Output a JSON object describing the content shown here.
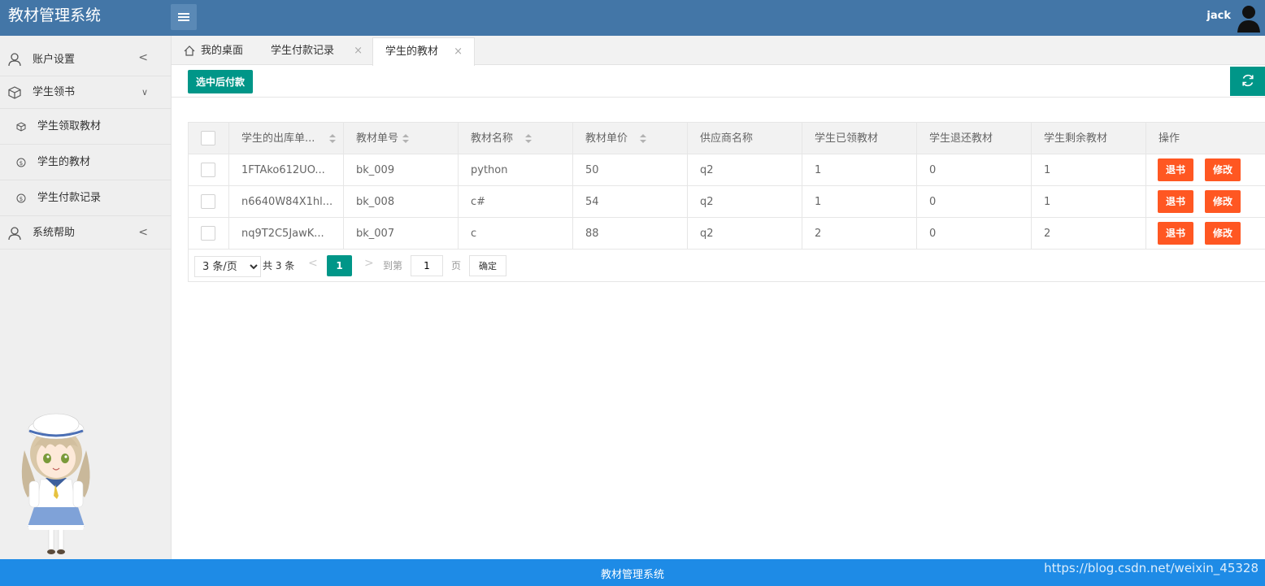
{
  "app": {
    "title": "教材管理系统",
    "user": "jack"
  },
  "sidebar": {
    "items": [
      {
        "label": "账户设置",
        "arrow": "<"
      },
      {
        "label": "学生领书",
        "arrow": "∨"
      },
      {
        "label": "学生领取教材"
      },
      {
        "label": "学生的教材"
      },
      {
        "label": "学生付款记录"
      },
      {
        "label": "系统帮助",
        "arrow": "<"
      }
    ]
  },
  "tabs": [
    {
      "label": "我的桌面"
    },
    {
      "label": "学生付款记录",
      "close": "×"
    },
    {
      "label": "学生的教材",
      "close": "×"
    }
  ],
  "toolbar": {
    "pay_label": "选中后付款"
  },
  "table": {
    "headers": [
      "学生的出库单...",
      "教材单号",
      "教材名称",
      "教材单价",
      "供应商名称",
      "学生已领教材",
      "学生退还教材",
      "学生剩余教材",
      "操作"
    ],
    "rows": [
      [
        "1FTAko612UO...",
        "bk_009",
        "python",
        "50",
        "q2",
        "1",
        "0",
        "1"
      ],
      [
        "n6640W84X1hl...",
        "bk_008",
        "c#",
        "54",
        "q2",
        "1",
        "0",
        "1"
      ],
      [
        "nq9T2C5JawK...",
        "bk_007",
        "c",
        "88",
        "q2",
        "2",
        "0",
        "2"
      ]
    ],
    "return_label": "退书",
    "edit_label": "修改"
  },
  "pager": {
    "page_size": "3 条/页",
    "total": "共 3 条",
    "current": "1",
    "goto": "到第",
    "goto_value": "1",
    "page_unit": "页",
    "confirm": "确定",
    "prev": "<",
    "next": ">"
  },
  "footer": {
    "text": "教材管理系统",
    "watermark": "https://blog.csdn.net/weixin_45328"
  },
  "colors": {
    "header": "#4376a7",
    "primary": "#009688",
    "danger": "#ff5722",
    "footer": "#1e8be6"
  }
}
